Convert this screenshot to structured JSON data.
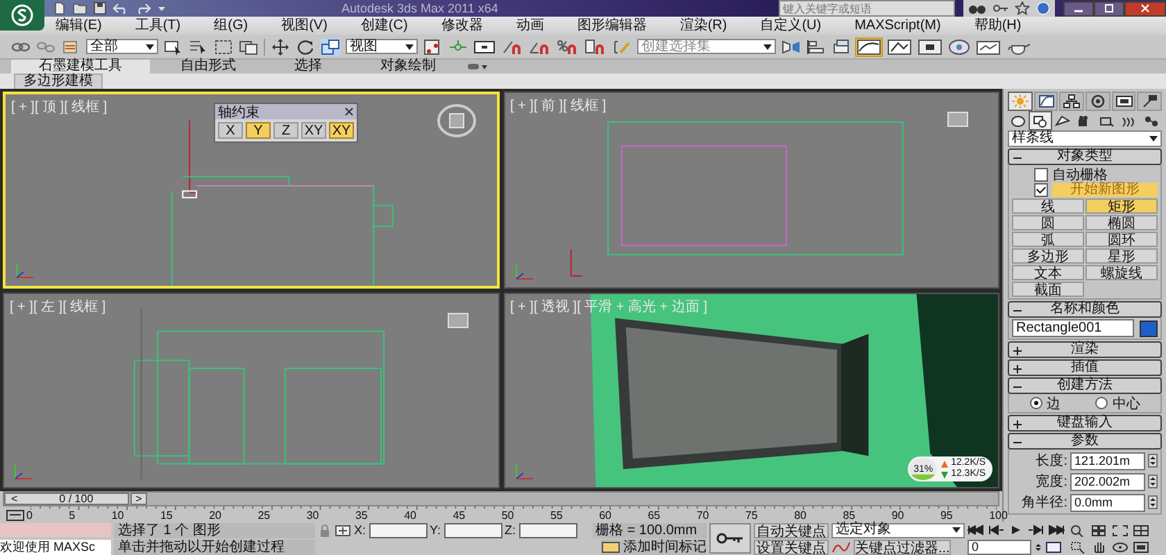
{
  "window": {
    "title": "Autodesk 3ds Max 2011 x64"
  },
  "search": {
    "placeholder": "键入关键字或短语"
  },
  "menu": [
    "编辑(E)",
    "工具(T)",
    "组(G)",
    "视图(V)",
    "创建(C)",
    "修改器",
    "动画",
    "图形编辑器",
    "渲染(R)",
    "自定义(U)",
    "MAXScript(M)",
    "帮助(H)"
  ],
  "toolbar": {
    "selection_filter": "全部",
    "reference_system": "视图",
    "named_selection": "创建选择集",
    "curve_editor_on": true
  },
  "ribbon": {
    "tabs": [
      {
        "label": "石墨建模工具",
        "selected": true
      },
      {
        "label": "自由形式",
        "selected": false
      },
      {
        "label": "选择",
        "selected": false
      },
      {
        "label": "对象绘制",
        "selected": false
      }
    ],
    "panel": "多边形建模"
  },
  "viewports": [
    {
      "label": "[ + ][ 顶 ][ 线框 ]",
      "kind": "top",
      "active": true
    },
    {
      "label": "[ + ][ 前 ][ 线框 ]",
      "kind": "front",
      "active": false
    },
    {
      "label": "[ + ][ 左 ][ 线框 ]",
      "kind": "left",
      "active": false
    },
    {
      "label": "[ + ][ 透视 ][ 平滑 + 高光 + 边面 ]",
      "kind": "perspective",
      "active": false
    }
  ],
  "axis_constraints": {
    "title": "轴约束",
    "buttons": [
      {
        "label": "X",
        "selected": false
      },
      {
        "label": "Y",
        "selected": true
      },
      {
        "label": "Z",
        "selected": false
      },
      {
        "label": "XY",
        "selected": false
      },
      {
        "label": "XY",
        "selected": true
      }
    ]
  },
  "net_meter": {
    "percent": "31%",
    "upload": "12.2K/S",
    "download": "12.3K/S"
  },
  "command_panel": {
    "tabs": [
      {
        "selected": true
      },
      {
        "selected": false
      },
      {
        "selected": false
      },
      {
        "selected": false
      },
      {
        "selected": false
      },
      {
        "selected": false
      }
    ],
    "subtypes": [
      {
        "selected": false
      },
      {
        "selected": true
      },
      {
        "selected": false
      },
      {
        "selected": false
      },
      {
        "selected": false
      },
      {
        "selected": false
      },
      {
        "selected": false
      }
    ],
    "category": "样条线",
    "rollouts": [
      {
        "title": "对象类型",
        "expanded": true,
        "kind": "object_type",
        "auto_grid": {
          "label": "自动栅格",
          "checked": false
        },
        "start_new_shape": {
          "label": "开始新图形",
          "checked": true
        },
        "buttons": [
          {
            "label": "线",
            "selected": false
          },
          {
            "label": "矩形",
            "selected": true
          },
          {
            "label": "圆",
            "selected": false
          },
          {
            "label": "椭圆",
            "selected": false
          },
          {
            "label": "弧",
            "selected": false
          },
          {
            "label": "圆环",
            "selected": false
          },
          {
            "label": "多边形",
            "selected": false
          },
          {
            "label": "星形",
            "selected": false
          },
          {
            "label": "文本",
            "selected": false
          },
          {
            "label": "螺旋线",
            "selected": false
          },
          {
            "label": "截面",
            "selected": false
          }
        ]
      },
      {
        "title": "名称和颜色",
        "expanded": true,
        "kind": "name_color",
        "name": "Rectangle001",
        "color": "#1f5fc8"
      },
      {
        "title": "渲染",
        "expanded": false
      },
      {
        "title": "插值",
        "expanded": false
      },
      {
        "title": "创建方法",
        "expanded": true,
        "kind": "creation_method",
        "options": [
          {
            "label": "边",
            "selected": true
          },
          {
            "label": "中心",
            "selected": false
          }
        ]
      },
      {
        "title": "键盘输入",
        "expanded": false
      },
      {
        "title": "参数",
        "expanded": true,
        "kind": "parameters",
        "fields": [
          {
            "label": "长度:",
            "value": "121.201m"
          },
          {
            "label": "宽度:",
            "value": "202.002m"
          },
          {
            "label": "角半径:",
            "value": "0.0mm"
          }
        ]
      }
    ]
  },
  "timeline": {
    "prev": "<",
    "position": "0 / 100",
    "next": ">",
    "ruler_labels": [
      "0",
      "5",
      "10",
      "15",
      "20",
      "25",
      "30",
      "35",
      "40",
      "45",
      "50",
      "55",
      "60",
      "65",
      "70",
      "75",
      "80",
      "85",
      "90",
      "95",
      "100"
    ]
  },
  "status": {
    "listener": "欢迎使用 MAXSc",
    "message": "选择了 1 个 图形",
    "prompt": "单击并拖动以开始创建过程",
    "x_label": "X:",
    "y_label": "Y:",
    "z_label": "Z:",
    "grid": "栅格 = 100.0mm",
    "add_time_tag": "添加时间标记",
    "auto_key": "自动关键点",
    "key_target": "选定对象",
    "set_key": "设置关键点",
    "key_filters": "关键点过滤器...",
    "frame": "0"
  }
}
